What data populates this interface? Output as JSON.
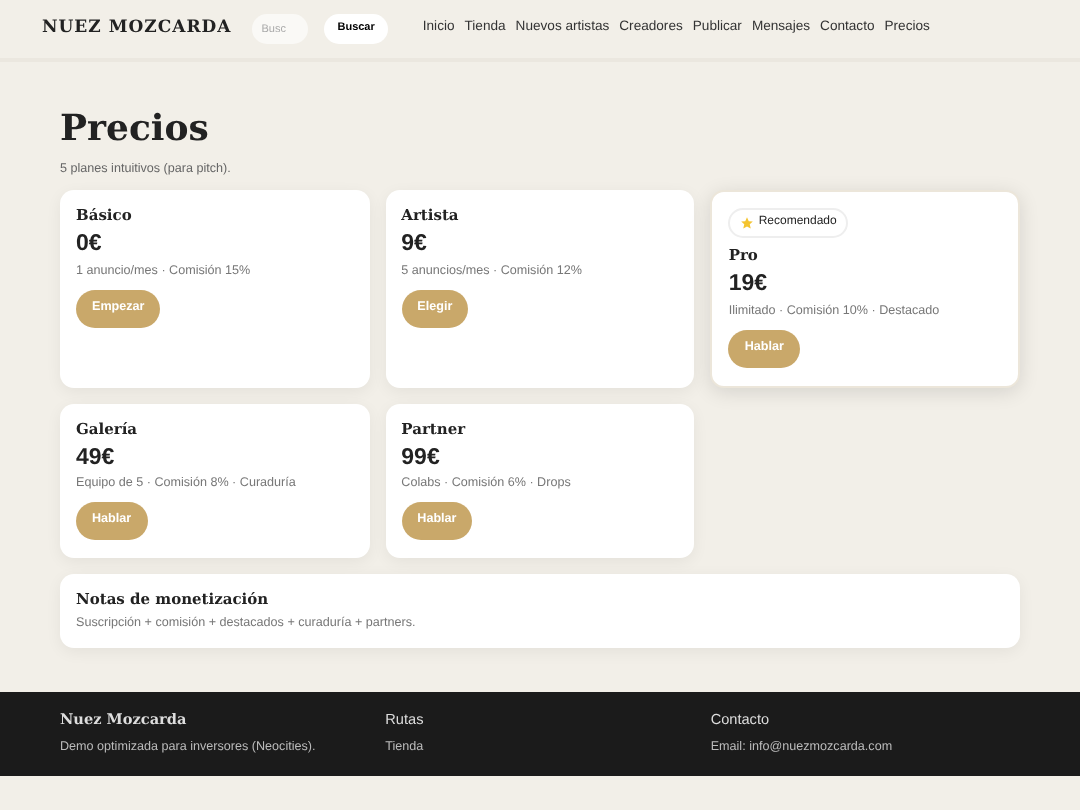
{
  "brand": "NUEZ MOZCARDA",
  "search": {
    "placeholder": "Busc",
    "button": "Buscar"
  },
  "nav": [
    {
      "label": "Inicio"
    },
    {
      "label": "Tienda"
    },
    {
      "label": "Nuevos artistas"
    },
    {
      "label": "Creadores"
    },
    {
      "label": "Publicar"
    },
    {
      "label": "Mensajes"
    },
    {
      "label": "Contacto"
    },
    {
      "label": "Precios"
    }
  ],
  "title": "Precios",
  "subtitle": "5 planes intuitivos (para pitch).",
  "plans": [
    {
      "name": "Básico",
      "price": "0€",
      "features": "1 anuncio/mes · Comisión 15%",
      "button": "Empezar"
    },
    {
      "name": "Artista",
      "price": "9€",
      "features": "5 anuncios/mes · Comisión 12%",
      "button": "Elegir"
    },
    {
      "name": "Pro",
      "price": "19€",
      "features": "Ilimitado · Comisión 10% · Destacado",
      "button": "Hablar",
      "badge": "Recomendado"
    },
    {
      "name": "Galería",
      "price": "49€",
      "features": "Equipo de 5 · Comisión 8% · Curaduría",
      "button": "Hablar"
    },
    {
      "name": "Partner",
      "price": "99€",
      "features": "Colabs · Comisión 6% · Drops",
      "button": "Hablar"
    }
  ],
  "notes": {
    "title": "Notas de monetización",
    "text": "Suscripción + comisión + destacados + curaduría + partners."
  },
  "footer": [
    {
      "title": "Nuez Mozcarda",
      "lines": [
        "Demo optimizada para inversores (Neocities)."
      ]
    },
    {
      "title": "Rutas",
      "lines": [
        "Tienda"
      ]
    },
    {
      "title": "Contacto",
      "lines": [
        "Email: info@nuezmozcarda.com"
      ]
    }
  ]
}
